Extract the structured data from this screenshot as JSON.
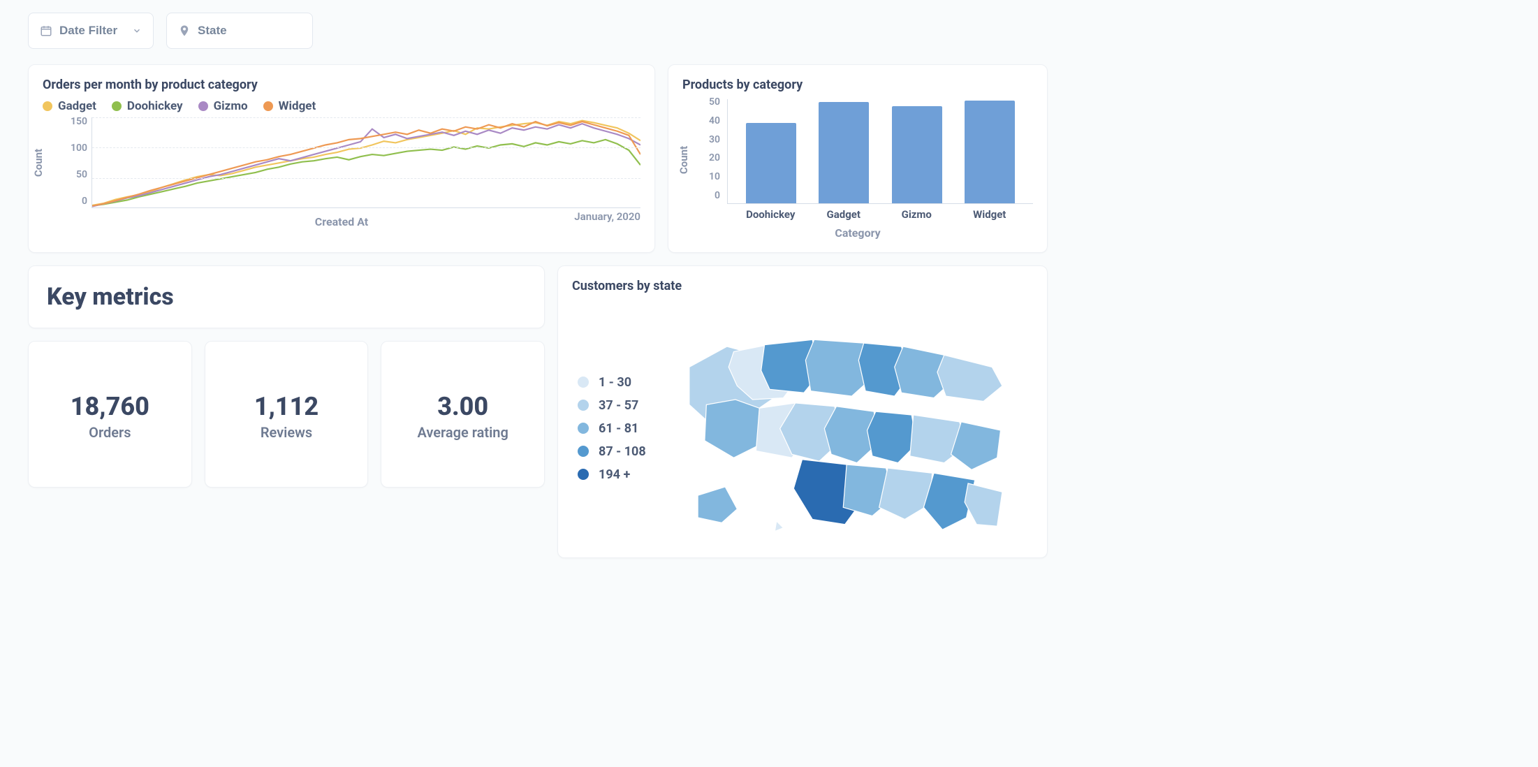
{
  "filters": {
    "date": {
      "label": "Date Filter"
    },
    "state": {
      "label": "State"
    }
  },
  "line_chart": {
    "title": "Orders per month by product category",
    "xlabel": "Created At",
    "ylabel": "Count",
    "x_annotation": "January, 2020",
    "legend": [
      {
        "name": "Gadget",
        "color": "#f1c55d"
      },
      {
        "name": "Doohickey",
        "color": "#90bf4e"
      },
      {
        "name": "Gizmo",
        "color": "#a989c4"
      },
      {
        "name": "Widget",
        "color": "#ee9953"
      }
    ],
    "y_ticks": [
      150,
      100,
      50,
      0
    ]
  },
  "bar_chart": {
    "title": "Products by category",
    "xlabel": "Category",
    "ylabel": "Count",
    "y_ticks": [
      50,
      40,
      30,
      20,
      10,
      0
    ]
  },
  "key_metrics": {
    "title": "Key metrics",
    "metrics": [
      {
        "value": "18,760",
        "label": "Orders"
      },
      {
        "value": "1,112",
        "label": "Reviews"
      },
      {
        "value": "3.00",
        "label": "Average rating"
      }
    ]
  },
  "map": {
    "title": "Customers by state",
    "legend": [
      {
        "label": "1 - 30",
        "color": "#d9e8f5"
      },
      {
        "label": "37 - 57",
        "color": "#b3d3ec"
      },
      {
        "label": "61 - 81",
        "color": "#82b7de"
      },
      {
        "label": "87 - 108",
        "color": "#5499cf"
      },
      {
        "label": "194 +",
        "color": "#2a6bb1"
      }
    ]
  },
  "chart_data": [
    {
      "type": "line",
      "title": "Orders per month by product category",
      "xlabel": "Created At",
      "ylabel": "Count",
      "ylim": [
        0,
        170
      ],
      "x_count": 48,
      "series": [
        {
          "name": "Gadget",
          "color": "#f1c55d",
          "values": [
            4,
            8,
            15,
            20,
            24,
            30,
            38,
            45,
            52,
            58,
            62,
            60,
            64,
            70,
            76,
            80,
            84,
            88,
            92,
            95,
            100,
            104,
            110,
            112,
            118,
            125,
            122,
            128,
            132,
            136,
            140,
            145,
            138,
            150,
            148,
            152,
            155,
            158,
            160,
            155,
            162,
            158,
            164,
            160,
            155,
            150,
            140,
            126
          ]
        },
        {
          "name": "Doohickey",
          "color": "#90bf4e",
          "values": [
            3,
            6,
            10,
            14,
            20,
            25,
            30,
            35,
            40,
            46,
            50,
            54,
            58,
            62,
            66,
            72,
            76,
            82,
            86,
            88,
            92,
            95,
            90,
            96,
            100,
            98,
            102,
            106,
            108,
            110,
            108,
            114,
            110,
            116,
            112,
            118,
            120,
            115,
            122,
            118,
            124,
            120,
            126,
            122,
            128,
            120,
            108,
            80
          ]
        },
        {
          "name": "Gizmo",
          "color": "#a989c4",
          "values": [
            2,
            7,
            12,
            18,
            22,
            28,
            34,
            40,
            46,
            52,
            58,
            62,
            68,
            74,
            80,
            86,
            92,
            88,
            94,
            100,
            106,
            112,
            118,
            124,
            148,
            132,
            138,
            130,
            134,
            138,
            142,
            136,
            144,
            138,
            146,
            140,
            150,
            146,
            152,
            148,
            156,
            150,
            158,
            150,
            144,
            138,
            130,
            118
          ]
        },
        {
          "name": "Widget",
          "color": "#ee9953",
          "values": [
            3,
            7,
            13,
            19,
            25,
            32,
            38,
            44,
            50,
            56,
            62,
            68,
            74,
            80,
            86,
            90,
            96,
            100,
            106,
            112,
            118,
            122,
            128,
            130,
            134,
            138,
            142,
            138,
            146,
            140,
            148,
            144,
            152,
            148,
            156,
            150,
            158,
            152,
            162,
            154,
            160,
            155,
            162,
            156,
            150,
            144,
            136,
            100
          ]
        }
      ]
    },
    {
      "type": "bar",
      "title": "Products by category",
      "xlabel": "Category",
      "ylabel": "Count",
      "ylim": [
        0,
        55
      ],
      "categories": [
        "Doohickey",
        "Gadget",
        "Gizmo",
        "Widget"
      ],
      "values": [
        42,
        53,
        51,
        54
      ]
    }
  ]
}
